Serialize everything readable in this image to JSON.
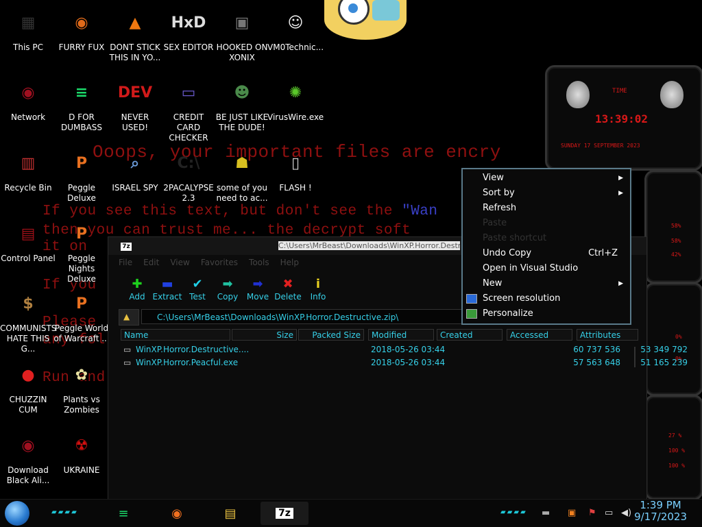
{
  "ransom_lines": [
    {
      "text": "Ooops, your important files are encry"
    },
    {
      "pre": "If you see this text, but don't see the ",
      "blue": "\"Wan"
    },
    {
      "text": "then you can trust me... the decrypt soft"
    },
    {
      "text": "it on"
    },
    {
      "text": "If you"
    },
    {
      "text": "Please"
    },
    {
      "text": "any fol"
    },
    {
      "text": "Run and"
    }
  ],
  "desktop_icons": [
    {
      "label": "This PC",
      "glyph": "▦",
      "color": "#333"
    },
    {
      "label": "FURRY FUX",
      "glyph": "◉",
      "color": "#e06a1a"
    },
    {
      "label": "DONT STICK THIS IN YO...",
      "glyph": "▲",
      "color": "#f07810"
    },
    {
      "label": "SEX EDITOR",
      "glyph": "HxD",
      "color": "#ddd"
    },
    {
      "label": "HOOKED ON XONIX",
      "glyph": "▣",
      "color": "#777"
    },
    {
      "label": "VM0Technic...",
      "glyph": "☺",
      "color": "#eee"
    },
    {
      "label": "Network",
      "glyph": "◉",
      "color": "#a01020"
    },
    {
      "label": "D FOR DUMBASS",
      "glyph": "≡",
      "color": "#1bd96a"
    },
    {
      "label": "NEVER USED!",
      "glyph": "DEV",
      "color": "#d01a1a"
    },
    {
      "label": "CREDIT CARD CHECKER",
      "glyph": "▭",
      "color": "#6a5acd"
    },
    {
      "label": "BE JUST LIKE THE DUDE!",
      "glyph": "☻",
      "color": "#4a8a4a"
    },
    {
      "label": "VirusWire.exe",
      "glyph": "✺",
      "color": "#5ac82a"
    },
    {
      "label": "Recycle Bin",
      "glyph": "▥",
      "color": "#c03030"
    },
    {
      "label": "Peggle Deluxe",
      "glyph": "P",
      "color": "#e87020"
    },
    {
      "label": "ISRAEL SPY",
      "glyph": "⌕",
      "color": "#6a9ad8"
    },
    {
      "label": "2PACALYPSE 2.3",
      "glyph": "C:\\",
      "color": "#222"
    },
    {
      "label": "some of you need to ac...",
      "glyph": "☗",
      "color": "#d8c020"
    },
    {
      "label": "FLASH !",
      "glyph": "▯",
      "color": "#ccc"
    },
    {
      "label": "Control Panel",
      "glyph": "▤",
      "color": "#a01018"
    },
    {
      "label": "Peggle Nights Deluxe",
      "glyph": "P",
      "color": "#e87020"
    },
    {
      "label": "COMMUNISTS HATE THIS G...",
      "glyph": "$",
      "color": "#b08040"
    },
    {
      "label": "Peggle World of Warcraft ...",
      "glyph": "P",
      "color": "#e87020"
    },
    {
      "label": "CHUZZIN CUM",
      "glyph": "●",
      "color": "#e02020"
    },
    {
      "label": "Plants vs Zombies",
      "glyph": "✿",
      "color": "#e8e0a0"
    },
    {
      "label": "Download Black Ali...",
      "glyph": "◉",
      "color": "#a01020"
    },
    {
      "label": "UKRAINE",
      "glyph": "☢",
      "color": "#d01010"
    }
  ],
  "widget": {
    "title": "TIME",
    "time": "13:39:02",
    "date": "SUNDAY 17 SEPTEMBER 2023",
    "stats_a": [
      "58%",
      "58%",
      "42%"
    ],
    "stats_b": [
      "0%",
      "0%"
    ],
    "stats_c": [
      "27 %",
      "100 %",
      "100 %"
    ]
  },
  "sevenzip": {
    "title": "C:\\Users\\MrBeast\\Downloads\\WinXP.Horror.Destructive.zip\\",
    "app_icon": "7z",
    "menu": [
      "File",
      "Edit",
      "View",
      "Favorites",
      "Tools",
      "Help"
    ],
    "toolbar": [
      {
        "label": "Add",
        "glyph": "✚",
        "color": "#1ed01e"
      },
      {
        "label": "Extract",
        "glyph": "▬",
        "color": "#2040e0"
      },
      {
        "label": "Test",
        "glyph": "✔",
        "color": "#20d0e8"
      },
      {
        "label": "Copy",
        "glyph": "➡",
        "color": "#20c0a0"
      },
      {
        "label": "Move",
        "glyph": "➡",
        "color": "#2030d0"
      },
      {
        "label": "Delete",
        "glyph": "✖",
        "color": "#e02020"
      },
      {
        "label": "Info",
        "glyph": "i",
        "color": "#e8d020"
      }
    ],
    "address": "C:\\Users\\MrBeast\\Downloads\\WinXP.Horror.Destructive.zip\\",
    "columns": [
      "Name",
      "Size",
      "Packed Size",
      "Modified",
      "Created",
      "Accessed",
      "Attributes"
    ],
    "files": [
      {
        "name": "WinXP.Horror.Destructive....",
        "size": "60 737 536",
        "packed": "53 349 792",
        "modified": "2018-05-26 03:44"
      },
      {
        "name": "WinXP.Horror.Peacful.exe",
        "size": "57 563 648",
        "packed": "51 165 239",
        "modified": "2018-05-26 03:44"
      }
    ]
  },
  "context_menu": {
    "items": [
      {
        "label": "View",
        "submenu": true,
        "disabled": false,
        "shortcut": ""
      },
      {
        "label": "Sort by",
        "submenu": true,
        "disabled": false,
        "shortcut": ""
      },
      {
        "label": "Refresh",
        "submenu": false,
        "disabled": false,
        "shortcut": ""
      },
      {
        "label": "Paste",
        "submenu": false,
        "disabled": true,
        "shortcut": ""
      },
      {
        "label": "Paste shortcut",
        "submenu": false,
        "disabled": true,
        "shortcut": ""
      },
      {
        "label": "Undo Copy",
        "submenu": false,
        "disabled": false,
        "shortcut": "Ctrl+Z"
      },
      {
        "label": "Open in Visual Studio",
        "submenu": false,
        "disabled": false,
        "shortcut": ""
      },
      {
        "label": "New",
        "submenu": true,
        "disabled": false,
        "shortcut": ""
      },
      {
        "label": "Screen resolution",
        "submenu": false,
        "disabled": false,
        "shortcut": "",
        "icon": "monitor-icon"
      },
      {
        "label": "Personalize",
        "submenu": false,
        "disabled": false,
        "shortcut": "",
        "icon": "personalize-icon"
      }
    ]
  },
  "taskbar": {
    "apps": [
      {
        "name": "app-green",
        "glyph": "≡",
        "color": "#1bd96a"
      },
      {
        "name": "firefox",
        "glyph": "◉",
        "color": "#f07020"
      },
      {
        "name": "file-explorer",
        "glyph": "▤",
        "color": "#e8c040"
      },
      {
        "name": "sevenzip",
        "glyph": "7z",
        "color": "#fff"
      }
    ],
    "time": "1:39 PM",
    "date": "9/17/2023"
  }
}
